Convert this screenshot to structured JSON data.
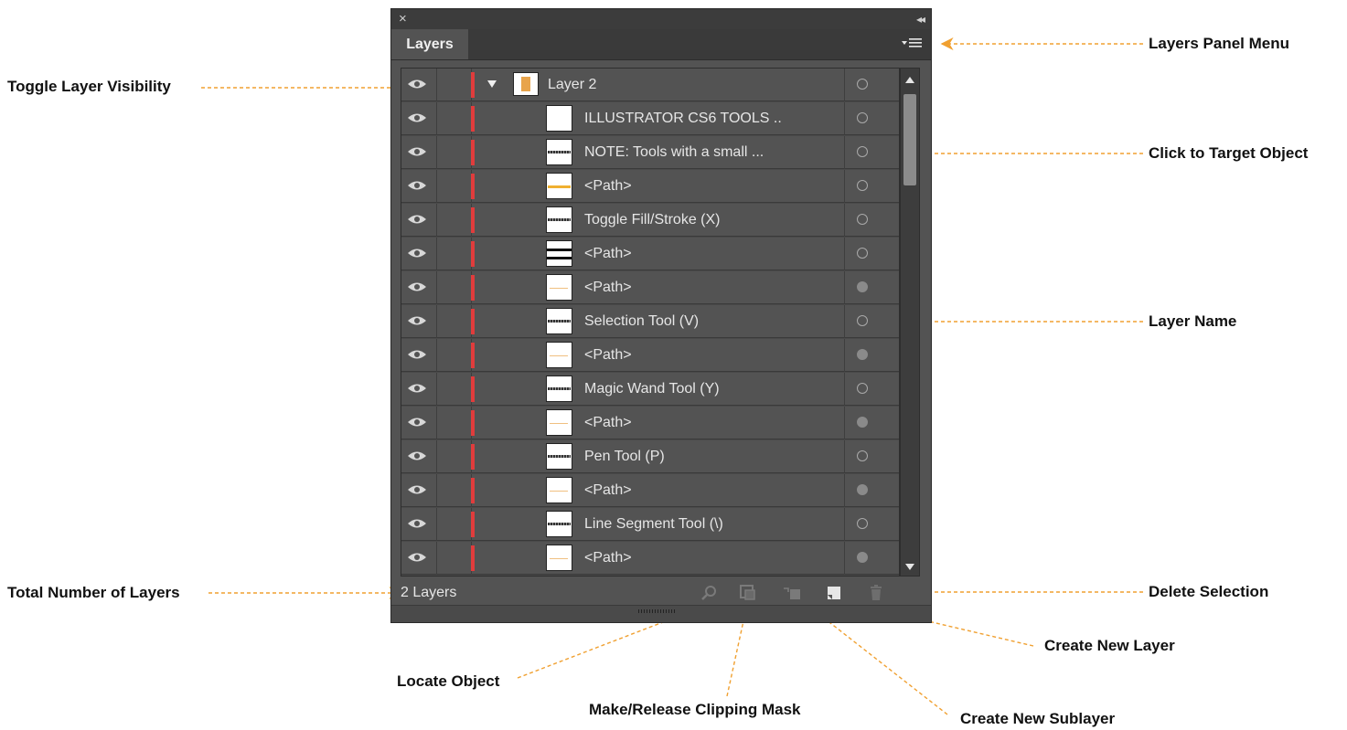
{
  "panel": {
    "close_glyph": "×",
    "collapse_glyph": "◂◂",
    "tab_label": "Layers",
    "menu_icon": "panel-menu-icon",
    "layer_count": "2 Layers"
  },
  "layers": [
    {
      "name": "Layer 2",
      "type": "layer",
      "target_filled": false
    },
    {
      "name": "ILLUSTRATOR CS6 TOOLS ..",
      "target_filled": false,
      "thumb": "blank"
    },
    {
      "name": "NOTE: Tools with a small ...",
      "target_filled": false,
      "thumb": "text"
    },
    {
      "name": "<Path>",
      "target_filled": false,
      "thumb": "orange-line"
    },
    {
      "name": "Toggle Fill/Stroke (X)",
      "target_filled": false,
      "thumb": "text"
    },
    {
      "name": "<Path>",
      "target_filled": false,
      "thumb": "black-lines"
    },
    {
      "name": "<Path>",
      "target_filled": true,
      "thumb": "thin-orange"
    },
    {
      "name": "Selection Tool (V)",
      "target_filled": false,
      "thumb": "text"
    },
    {
      "name": "<Path>",
      "target_filled": true,
      "thumb": "thin-orange"
    },
    {
      "name": "Magic Wand Tool (Y)",
      "target_filled": false,
      "thumb": "text"
    },
    {
      "name": "<Path>",
      "target_filled": true,
      "thumb": "thin-orange"
    },
    {
      "name": "Pen Tool (P)",
      "target_filled": false,
      "thumb": "text"
    },
    {
      "name": "<Path>",
      "target_filled": true,
      "thumb": "thin-orange"
    },
    {
      "name": "Line Segment Tool (\\)",
      "target_filled": false,
      "thumb": "text"
    },
    {
      "name": "<Path>",
      "target_filled": true,
      "thumb": "thin-orange"
    }
  ],
  "callouts": {
    "layers_panel_menu": "Layers Panel Menu",
    "toggle_visibility": "Toggle Layer Visibility",
    "click_to_target": "Click to Target Object",
    "layer_name": "Layer Name",
    "total_layers": "Total Number of Layers",
    "delete_selection": "Delete Selection",
    "create_new_layer": "Create New Layer",
    "locate_object": "Locate Object",
    "clipping_mask": "Make/Release Clipping Mask",
    "create_sublayer": "Create New Sublayer"
  },
  "colors": {
    "panel_bg": "#535353",
    "layer_color": "#e03c3c",
    "callout_arrow": "#f0a030"
  }
}
